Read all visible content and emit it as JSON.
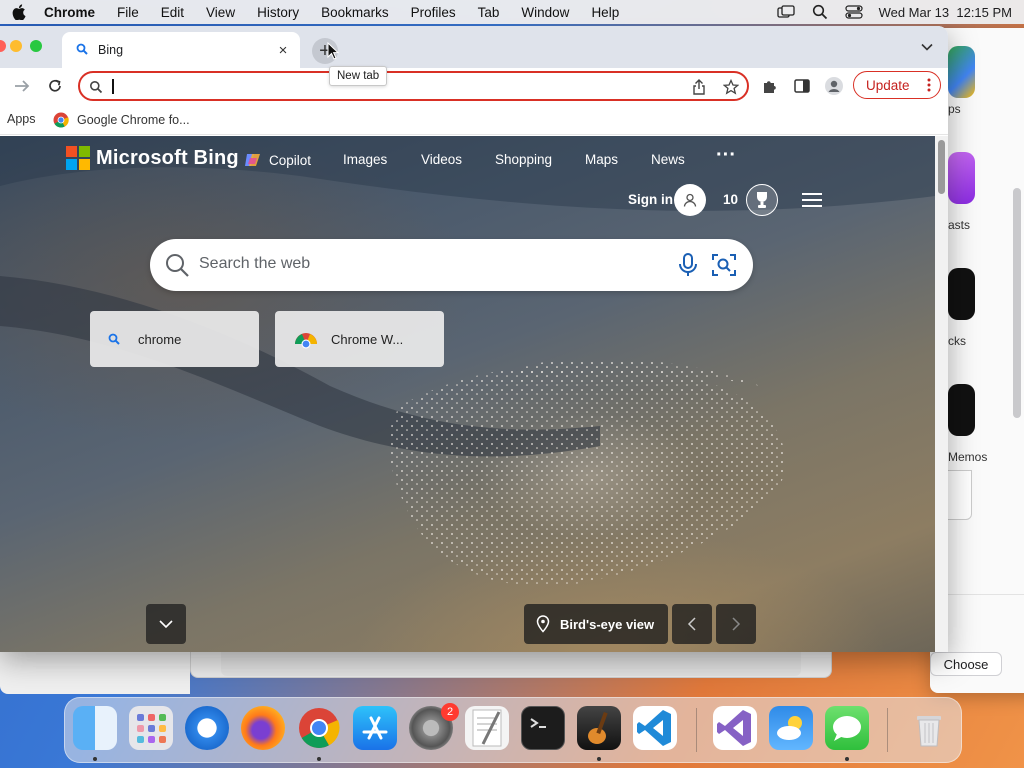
{
  "menubar": {
    "app_name": "Chrome",
    "items": [
      "File",
      "Edit",
      "View",
      "History",
      "Bookmarks",
      "Profiles",
      "Tab",
      "Window",
      "Help"
    ],
    "datetime": "Wed Mar 13  12:15 PM"
  },
  "background_window": {
    "labels": [
      "ps",
      "asts",
      "cks",
      "Memos"
    ],
    "choose_button": "Choose"
  },
  "browser": {
    "tab": {
      "title": "Bing",
      "close_glyph": "×"
    },
    "new_tab_glyph": "+",
    "new_tab_tooltip": "New tab",
    "omnibox": {
      "value": ""
    },
    "update_button": "Update",
    "bookmarks": [
      {
        "label": "Apps"
      },
      {
        "label": "Google Chrome fo..."
      }
    ]
  },
  "bing": {
    "logo_text": "Microsoft Bing",
    "nav": {
      "copilot": "Copilot",
      "images": "Images",
      "videos": "Videos",
      "shopping": "Shopping",
      "maps": "Maps",
      "news": "News",
      "more": "···"
    },
    "sign_in": "Sign in",
    "reward_points": "10",
    "search_placeholder": "Search the web",
    "suggestions": [
      {
        "text": "chrome",
        "icon": "search-icon"
      },
      {
        "text": "Chrome W...",
        "icon": "chrome-icon"
      }
    ],
    "image_caption": "Bird's-eye view"
  },
  "dock": {
    "apps": [
      "Finder",
      "Launchpad",
      "Safari",
      "Firefox",
      "Chrome",
      "App Store",
      "System Settings",
      "TextEdit",
      "Terminal",
      "GarageBand",
      "VS Code",
      "Visual Studio",
      "Weather",
      "Messages",
      "Trash"
    ],
    "settings_badge": "2"
  },
  "colors": {
    "accent_red": "#d93025",
    "bing_blue": "#0078d4"
  }
}
